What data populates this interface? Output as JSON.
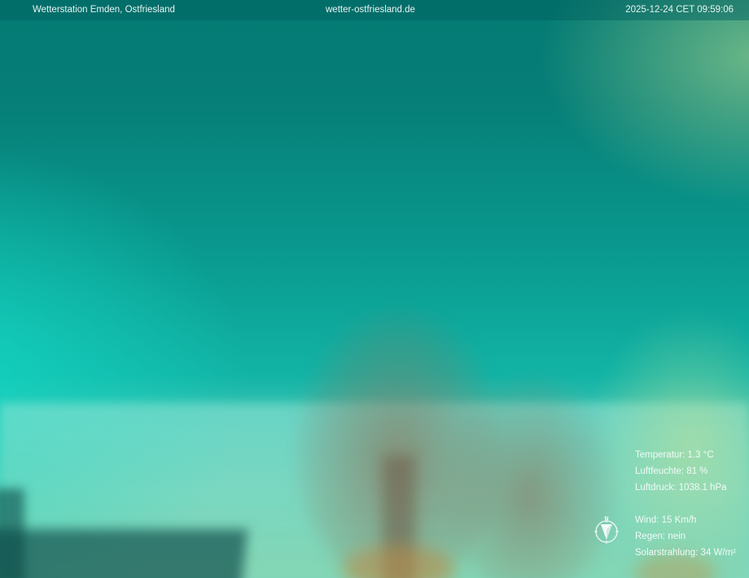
{
  "header": {
    "station": "Wetterstation Emden, Ostfriesland",
    "website": "wetter-ostfriesland.de",
    "timestamp": "2025-12-24 CET 09:59:06"
  },
  "readings": {
    "temperature": "Temperatur: 1.3 °C",
    "humidity": "Luftfeuchte: 81 %",
    "pressure": "Luftdruck: 1038.1 hPa",
    "wind": "Wind: 15 Km/h",
    "rain": "Regen: nein",
    "solar": "Solarstrahlung: 34 W/m²"
  },
  "compass": {
    "north_label": "N",
    "icon": "compass-icon",
    "color": "#f2faf8"
  },
  "colors": {
    "sky_top": "#047a73",
    "sky_bottom": "#7ed8bd",
    "text": "#f2faf8"
  }
}
